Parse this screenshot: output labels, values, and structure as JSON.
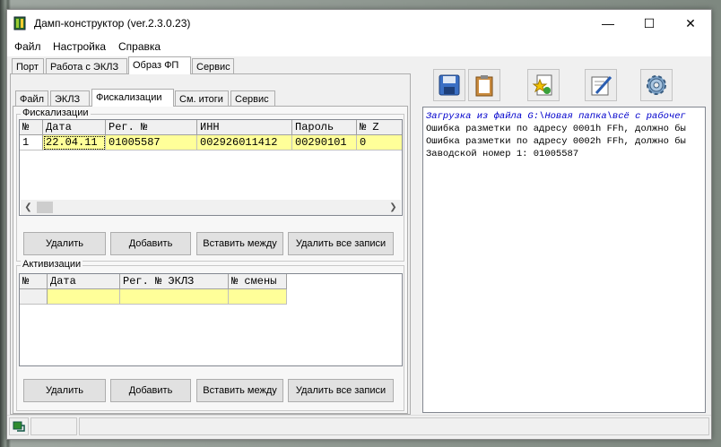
{
  "window": {
    "title": "Дамп-конструктор  (ver.2.3.0.23)"
  },
  "menu": [
    "Файл",
    "Настройка",
    "Справка"
  ],
  "outer_tabs": [
    "Порт",
    "Работа с ЭКЛЗ",
    "Образ ФП",
    "Сервис"
  ],
  "inner_tabs": [
    "Файл",
    "ЭКЛЗ",
    "Фискализации",
    "См. итоги",
    "Сервис"
  ],
  "fiscal": {
    "group_label": "Фискализации",
    "columns": [
      "№",
      "Дата",
      "Рег. №",
      "ИНН",
      "Пароль",
      "№ Z"
    ],
    "rows": [
      {
        "num": "1",
        "date": "22.04.11",
        "reg": "01005587",
        "inn": "002926011412",
        "password": "00290101",
        "z": "0"
      }
    ],
    "buttons": [
      "Удалить",
      "Добавить",
      "Вставить между",
      "Удалить все записи"
    ]
  },
  "activation": {
    "group_label": "Активизации",
    "columns": [
      "№",
      "Дата",
      "Рег. № ЭКЛЗ",
      "№ смены"
    ],
    "buttons": [
      "Удалить",
      "Добавить",
      "Вставить между",
      "Удалить все записи"
    ]
  },
  "toolbar": {
    "icons": [
      "save-icon",
      "clipboard-icon",
      "star-document-icon",
      "pen-document-icon",
      "gear-icon"
    ]
  },
  "log": [
    "Загрузка из файла G:\\Новая папка\\всё с рабочег",
    "Ошибка разметки по адресу 0001h FFh, должно бы",
    "Ошибка разметки по адресу 0002h FFh, должно бы",
    "Заводской номер 1: 01005587"
  ],
  "caption": {
    "minimize": "—",
    "maximize": "☐",
    "close": "✕"
  },
  "colors": {
    "row_highlight": "#ffff99",
    "log_first_line": "#0000cc"
  }
}
